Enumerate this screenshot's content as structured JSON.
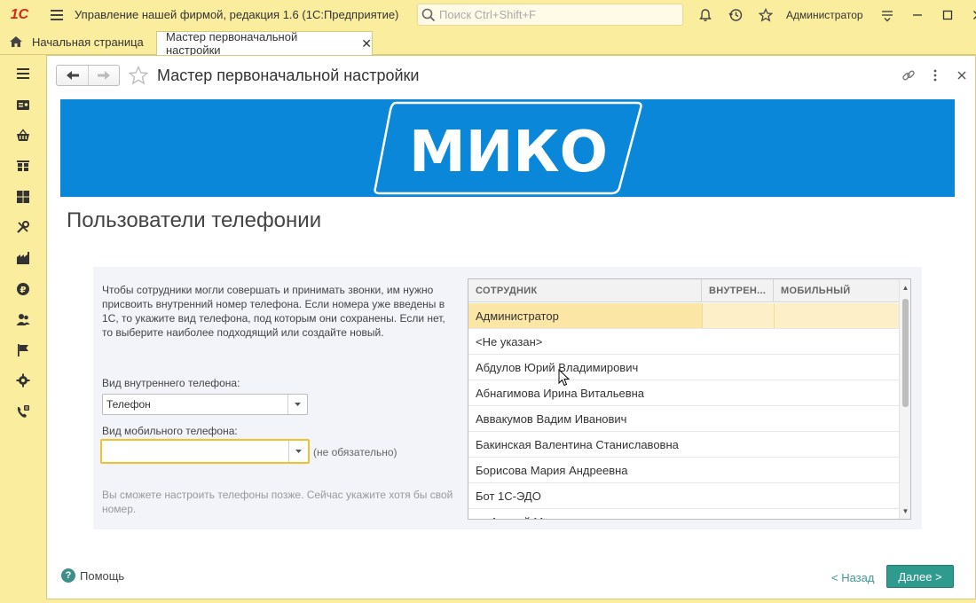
{
  "app": {
    "title": "Управление нашей фирмой, редакция 1.6  (1С:Предприятие)",
    "logo_text": "1С",
    "search_placeholder": "Поиск Ctrl+Shift+F",
    "user": "Администратор"
  },
  "tabs": {
    "home_label": "Начальная страница",
    "active_label": "Мастер первоначальной настройки",
    "close_glyph": "✕"
  },
  "form": {
    "title": "Мастер первоначальной настройки",
    "banner_logo": "МИКО",
    "heading": "Пользователи телефонии",
    "description": "Чтобы сотрудники могли совершать и принимать звонки, им нужно присвоить внутренний номер телефона. Если номера уже введены в 1С, то укажите вид телефона, под которым они сохранены. Если нет, то выберите наиболее подходящий или создайте новый.",
    "internal_phone_label": "Вид внутреннего телефона:",
    "internal_phone_value": "Телефон",
    "mobile_phone_label": "Вид мобильного телефона:",
    "mobile_phone_value": "",
    "optional_text": "(не обязательно)",
    "note": "Вы сможете настроить телефоны позже. Сейчас укажите хотя бы свой номер."
  },
  "table": {
    "headers": [
      "СОТРУДНИК",
      "ВНУТРЕН...",
      "МОБИЛЬНЫЙ"
    ],
    "rows": [
      {
        "employee": "Администратор",
        "internal": "",
        "mobile": ""
      },
      {
        "employee": "<Не указан>",
        "internal": "",
        "mobile": ""
      },
      {
        "employee": "Абдулов Юрий Владимирович",
        "internal": "",
        "mobile": ""
      },
      {
        "employee": "Абнагимова Ирина Витальевна",
        "internal": "",
        "mobile": ""
      },
      {
        "employee": "Аввакумов Вадим Иванович",
        "internal": "",
        "mobile": ""
      },
      {
        "employee": "Бакинская Валентина Станиславовна",
        "internal": "",
        "mobile": ""
      },
      {
        "employee": "Борисова Мария Андреевна",
        "internal": "",
        "mobile": ""
      },
      {
        "employee": "Бот 1С-ЭДО",
        "internal": "",
        "mobile": ""
      },
      {
        "employee": "… Андрей Ма…",
        "internal": "",
        "mobile": ""
      }
    ],
    "selected_row": 0
  },
  "footer": {
    "help_label": "Помощь",
    "back_label": "< Назад",
    "next_label": "Далее >"
  },
  "colors": {
    "titlebar_bg": "#fbed9e",
    "banner_bg": "#0a87d8",
    "accent_teal": "#2f9b8f",
    "selection": "#fbe6a6",
    "focus_border": "#f5c12b"
  },
  "icons": {
    "sidebar": [
      "menu-icon",
      "sales-icon",
      "purchases-icon",
      "warehouse-icon",
      "production-icon",
      "services-icon",
      "company-icon",
      "money-icon",
      "staff-icon",
      "reports-icon",
      "settings-icon",
      "telephony-icon"
    ]
  }
}
